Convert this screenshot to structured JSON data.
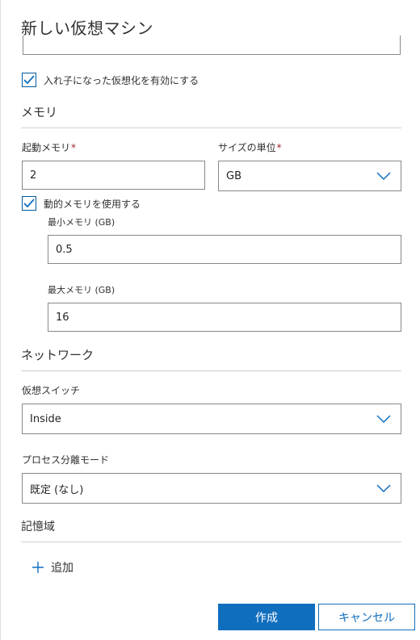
{
  "panel": {
    "title": "新しい仮想マシン"
  },
  "nested_virtualization": {
    "label": "入れ子になった仮想化を有効にする",
    "checked": true
  },
  "memory": {
    "section_title": "メモリ",
    "startup_label": "起動メモリ",
    "startup_required": "*",
    "startup_value": "2",
    "unit_label": "サイズの単位",
    "unit_required": "*",
    "unit_value": "GB",
    "dynamic_label": "動的メモリを使用する",
    "dynamic_checked": true,
    "min_label": "最小メモリ (GB)",
    "min_value": "0.5",
    "max_label": "最大メモリ (GB)",
    "max_value": "16"
  },
  "network": {
    "section_title": "ネットワーク",
    "switch_label": "仮想スイッチ",
    "switch_value": "Inside"
  },
  "isolation": {
    "label": "プロセス分離モード",
    "value": "既定 (なし)"
  },
  "storage": {
    "section_title": "記憶域",
    "add_label": "追加"
  },
  "footer": {
    "create_label": "作成",
    "cancel_label": "キャンセル"
  },
  "colors": {
    "accent": "#106ebe",
    "required": "#a4262c",
    "border": "#8a8886"
  }
}
